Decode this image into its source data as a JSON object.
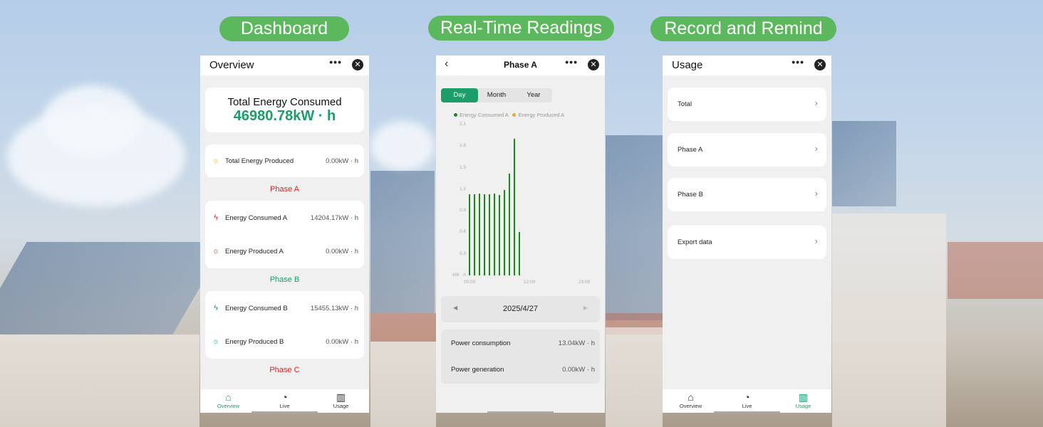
{
  "labels": {
    "dashboard": "Dashboard",
    "realtime": "Real-Time Readings",
    "record": "Record and Remind"
  },
  "overview": {
    "title": "Overview",
    "more": "•••",
    "close": "✕",
    "total_consumed_label": "Total Energy Consumed",
    "total_consumed_value": "46980.78kW · h",
    "total_produced_label": "Total Energy Produced",
    "total_produced_value": "0.00kW · h",
    "phase_a": "Phase A",
    "phase_b": "Phase B",
    "phase_c": "Phase C",
    "rows": [
      {
        "label": "Energy Consumed A",
        "value": "14204.17kW · h"
      },
      {
        "label": "Energy Produced A",
        "value": "0.00kW · h"
      },
      {
        "label": "Energy Consumed B",
        "value": "15455.13kW · h"
      },
      {
        "label": "Energy Produced B",
        "value": "0.00kW · h"
      }
    ]
  },
  "tabs": [
    {
      "label": "Overview"
    },
    {
      "label": "Live"
    },
    {
      "label": "Usage"
    }
  ],
  "live": {
    "title": "Phase A",
    "back": "‹",
    "segments": [
      "Day",
      "Month",
      "Year"
    ],
    "date": "2025/4/27",
    "prev": "◀",
    "next": "▶",
    "power_consumption_label": "Power consumption",
    "power_consumption_value": "13.04kW · h",
    "power_generation_label": "Power generation",
    "power_generation_value": "0.00kW · h"
  },
  "usage": {
    "title": "Usage",
    "items": [
      "Total",
      "Phase A",
      "Phase B",
      "Export data"
    ],
    "chevron": "›"
  },
  "colors": {
    "accent": "#1e9c6a",
    "pill": "#5cb85c",
    "phase_a": "#e02020",
    "consumed": "#178a17",
    "produced": "#f5a623"
  },
  "chart_data": {
    "type": "bar",
    "legend": [
      "Energy Consumed A",
      "Energy Produced A"
    ],
    "ylabel": "kW · h",
    "ylim": [
      0,
      2.1
    ],
    "yticks": [
      "2.1",
      "1.8",
      "1.5",
      "1.2",
      "0.9",
      "0.6",
      "0.3"
    ],
    "xticks": [
      "00:00",
      "12:00",
      "23:00"
    ],
    "xlim": [
      0,
      23
    ],
    "series": [
      {
        "name": "Energy Consumed A",
        "x": [
          0,
          1,
          2,
          3,
          4,
          5,
          6,
          7,
          8,
          9,
          10
        ],
        "values": [
          1.13,
          1.13,
          1.14,
          1.13,
          1.13,
          1.14,
          1.12,
          1.19,
          1.42,
          1.9,
          0.6
        ]
      },
      {
        "name": "Energy Produced A",
        "x": [],
        "values": []
      }
    ]
  }
}
